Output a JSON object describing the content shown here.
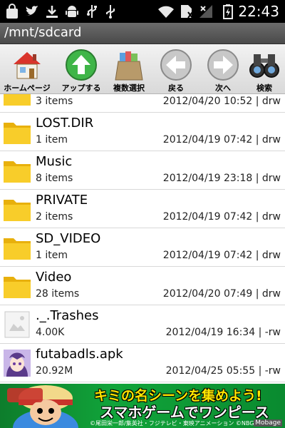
{
  "status_bar": {
    "time": "22:43",
    "icons": [
      "shopping-bag-icon",
      "twitter-icon",
      "download-icon",
      "android-icon",
      "usb-debug-icon",
      "usb-icon",
      "wifi-icon",
      "no-sim-icon",
      "signal-icon",
      "battery-icon"
    ]
  },
  "path": "/mnt/sdcard",
  "toolbar": {
    "home": "ホームページ",
    "up": "アップする",
    "multi_select": "複数選択",
    "back": "戻る",
    "next": "次へ",
    "search": "検索"
  },
  "files": [
    {
      "name": "",
      "size": "3 items",
      "date": "2012/04/20 10:52 | drw",
      "icon": "folder-icon"
    },
    {
      "name": "LOST.DIR",
      "size": "1 item",
      "date": "2012/04/19 07:42 | drw",
      "icon": "folder-icon"
    },
    {
      "name": "Music",
      "size": "8 items",
      "date": "2012/04/19 23:18 | drw",
      "icon": "folder-icon"
    },
    {
      "name": "PRIVATE",
      "size": "2 items",
      "date": "2012/04/19 07:42 | drw",
      "icon": "folder-icon"
    },
    {
      "name": "SD_VIDEO",
      "size": "1 item",
      "date": "2012/04/19 07:42 | drw",
      "icon": "folder-icon"
    },
    {
      "name": "Video",
      "size": "28 items",
      "date": "2012/04/20 07:49 | drw",
      "icon": "folder-icon"
    },
    {
      "name": "._.Trashes",
      "size": "4.00K",
      "date": "2012/04/19 16:34 | -rw",
      "icon": "file-icon"
    },
    {
      "name": "futabadls.apk",
      "size": "20.92M",
      "date": "2012/04/25 05:55 | -rw",
      "icon": "apk-icon"
    }
  ],
  "banner": {
    "line1": "キミの名シーンを集めよう!",
    "line2": "スマホゲームでワンピース",
    "copyright": "©尾田栄一郎/集英社・フジテレビ・東映アニメーション ©NBGI",
    "badge": "Mobage"
  },
  "colors": {
    "folder": "#f5c518",
    "path_bar": "#5a5a5a",
    "banner_green": "#11a43a"
  }
}
